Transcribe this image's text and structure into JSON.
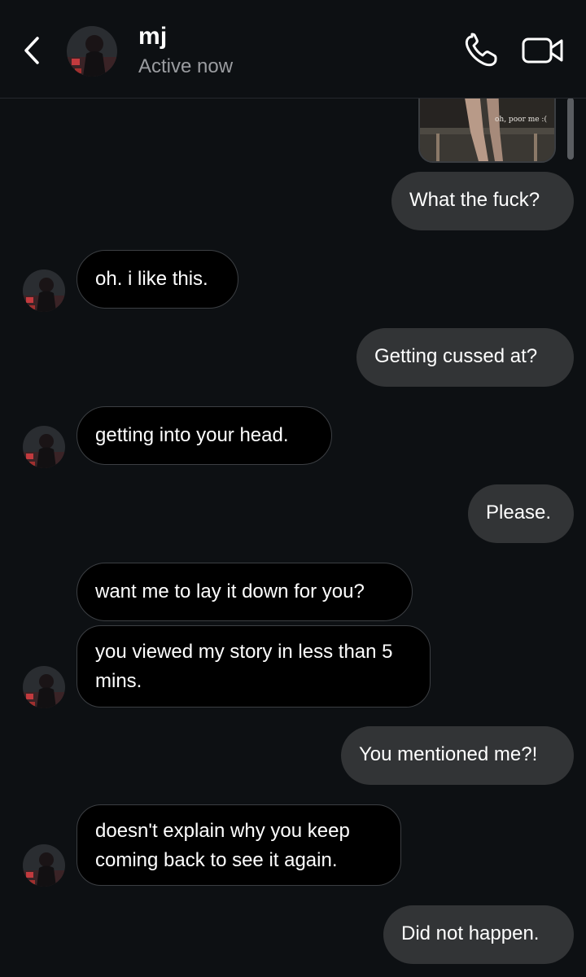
{
  "header": {
    "contact_name": "mj",
    "status": "Active now",
    "back_icon": "chevron-left-icon",
    "call_icon": "phone-icon",
    "video_icon": "video-camera-icon"
  },
  "shared_media": {
    "caption": "oh, poor me :("
  },
  "messages": [
    {
      "side": "sent",
      "text": "What the fuck?"
    },
    {
      "side": "received",
      "text": "oh. i like this."
    },
    {
      "side": "sent",
      "text": "Getting cussed at?"
    },
    {
      "side": "received",
      "text": "getting into your head."
    },
    {
      "side": "sent",
      "text": "Please."
    },
    {
      "side": "received",
      "text": "want me to lay it down for you?"
    },
    {
      "side": "received",
      "text": "you viewed my story in less than 5 mins."
    },
    {
      "side": "sent",
      "text": "You mentioned me?!"
    },
    {
      "side": "received",
      "text": "doesn't explain why you keep coming back to see it again."
    },
    {
      "side": "sent",
      "text": "Did not happen."
    }
  ],
  "colors": {
    "background": "#0d1013",
    "sent_bubble": "#323436",
    "received_bubble": "#000000",
    "received_border": "#3c3f43",
    "status_text": "#9a9ca0"
  }
}
